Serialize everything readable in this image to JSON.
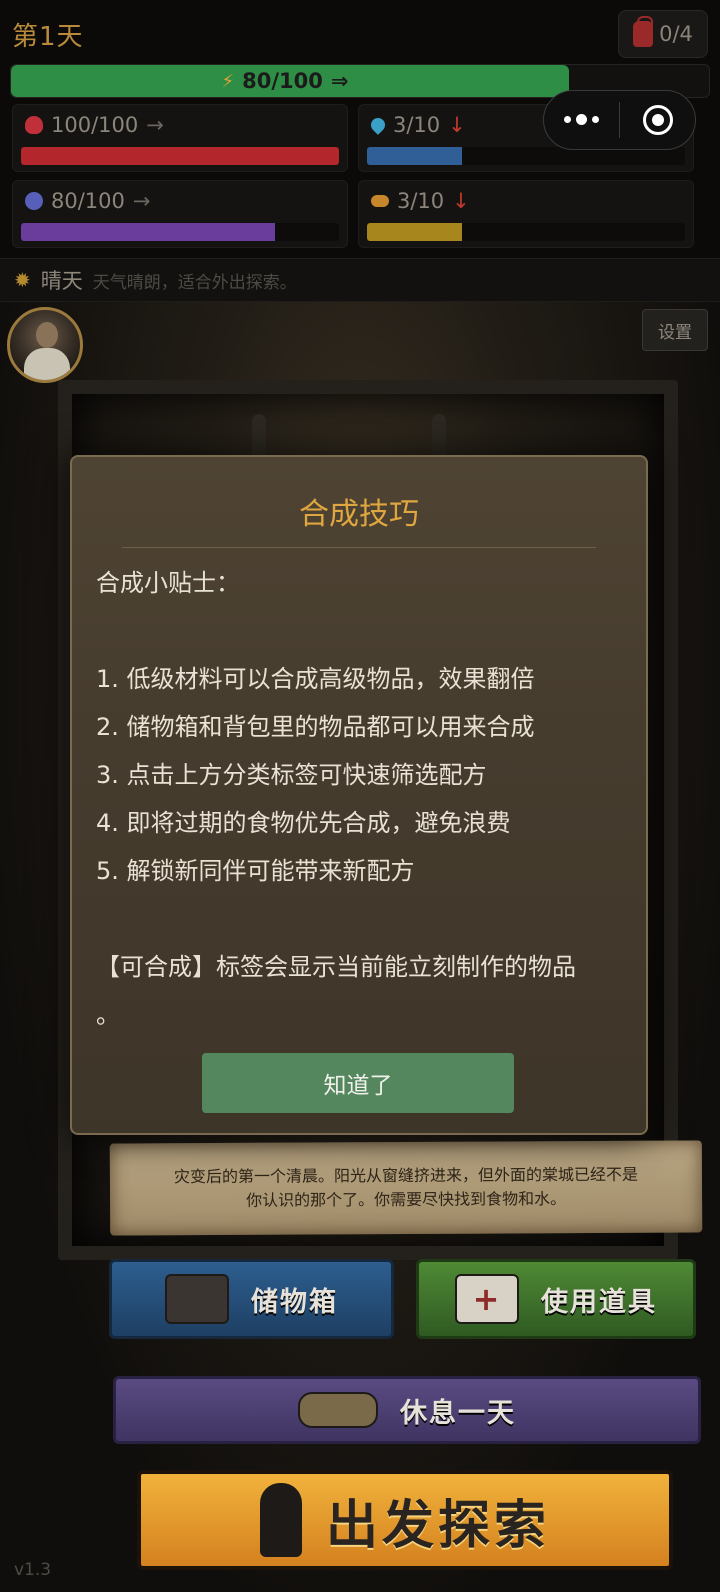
{
  "header": {
    "day_label": "第1天",
    "bag_count": "0/4",
    "bag_icon": "backpack-icon"
  },
  "energy": {
    "icon": "lightning-bolt-icon",
    "text": "80/100",
    "arrow": "⇒",
    "fraction": 0.8,
    "color": "#2f8e45"
  },
  "stats": [
    {
      "name": "health",
      "icon": "heart-icon",
      "text": "100/100",
      "trend": "→",
      "fraction": 1.0,
      "color": "#b3262b"
    },
    {
      "name": "water",
      "icon": "water-drop-icon",
      "text": "3/10",
      "trend": "↓",
      "fraction": 0.3,
      "color": "#2f5f96"
    },
    {
      "name": "sanity",
      "icon": "brain-icon",
      "text": "80/100",
      "trend": "→",
      "fraction": 0.8,
      "color": "#6a3d9c"
    },
    {
      "name": "food",
      "icon": "bread-icon",
      "text": "3/10",
      "trend": "↓",
      "fraction": 0.3,
      "color": "#a7871d"
    }
  ],
  "capsule": {
    "more_icon": "more-dots-icon",
    "close_icon": "target-close-icon"
  },
  "weather": {
    "icon": "sun-icon",
    "name": "晴天",
    "description": "天气晴朗，适合外出探索。"
  },
  "settings_label": "设置",
  "modal": {
    "title": "合成技巧",
    "intro": "合成小贴士：",
    "tips": [
      "1. 低级材料可以合成高级物品，效果翻倍",
      "2. 储物箱和背包里的物品都可以用来合成",
      "3. 点击上方分类标签可快速筛选配方",
      "4. 即将过期的食物优先合成，避免浪费",
      "5. 解锁新同伴可能带来新配方"
    ],
    "note_line1": "【可合成】标签会显示当前能立刻制作的物品",
    "note_line2": "。",
    "ok_label": "知道了"
  },
  "story": {
    "line1": "灾变后的第一个清晨。阳光从窗缝挤进来，但外面的棠城已经不是",
    "line2": "你认识的那个了。你需要尽快找到食物和水。"
  },
  "actions": {
    "storage_label": "储物箱",
    "use_items_label": "使用道具",
    "rest_label": "休息一天",
    "explore_label": "出发探索"
  },
  "version": "v1.3"
}
